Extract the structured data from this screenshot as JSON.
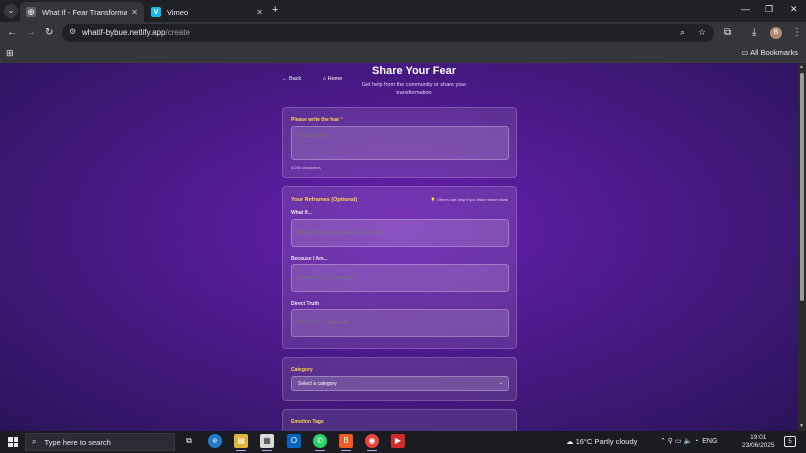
{
  "browser": {
    "tabs": [
      {
        "title": "What If - Fear Transformation A",
        "favicon": "globe-icon",
        "active": true
      },
      {
        "title": "Vimeo",
        "favicon": "V",
        "active": false
      }
    ],
    "url_host": "whatif-bybue.netlify.app",
    "url_path": "/create",
    "profile_initial": "B",
    "bookmarks_label": "All Bookmarks"
  },
  "page": {
    "title": "Share Your Fear",
    "back_label": "Back",
    "home_label": "Home",
    "subtitle": "Get help from the community or share your transformation",
    "fear_card": {
      "label": "Please write the fear",
      "required_mark": "*",
      "placeholder": "I'm afraid that...",
      "counter": "0/280 characters"
    },
    "reframes_card": {
      "title": "Your Reframes (Optional)",
      "hint": "Others can help if you leave these blank",
      "fields": [
        {
          "label": "What If...",
          "placeholder": "What if this fear is actually... (optional)"
        },
        {
          "label": "Because I Am...",
          "placeholder": "Because I am... (optional)"
        },
        {
          "label": "Direct Truth",
          "placeholder": "The truth is... (optional)"
        }
      ]
    },
    "category_card": {
      "label": "Category",
      "selected": "Select a category"
    },
    "emotion_card": {
      "label": "Emotion Tags"
    }
  },
  "taskbar": {
    "search_placeholder": "Type here to search",
    "weather": "16°C  Partly cloudy",
    "language": "ENG",
    "time": "19:01",
    "date": "23/06/2025",
    "notification_count": "5"
  },
  "colors": {
    "accent_label": "#ffd54f",
    "page_bg": "#5a1d9e"
  }
}
